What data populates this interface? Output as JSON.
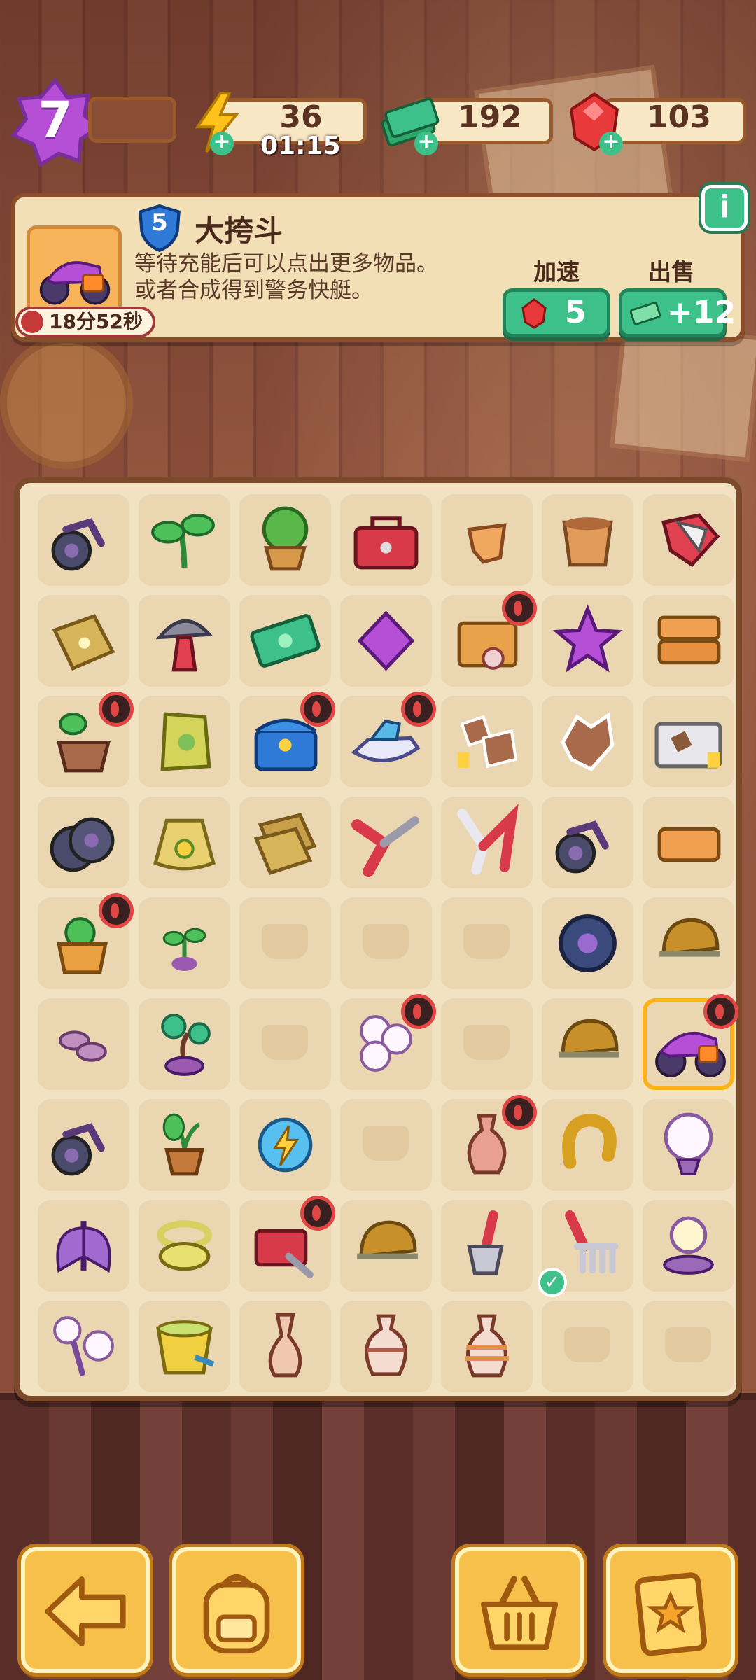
{
  "hud": {
    "level": "7",
    "energy": "36",
    "energy_timer": "01:15",
    "cash": "192",
    "gems": "103"
  },
  "item_panel": {
    "item_level": "5",
    "item_name": "大挎斗",
    "description_line1": "等待充能后可以点出更多物品。",
    "description_line2": "或者合成得到警务快艇。",
    "timer": "18分52秒",
    "speedup_label": "加速",
    "speedup_cost": "5",
    "sell_label": "出售",
    "sell_value": "+12",
    "info_label": "i"
  },
  "board": {
    "rows": [
      [
        "bike",
        "sprout",
        "tree-pot",
        "toolbox",
        "pot-shard",
        "clay-pot",
        "gloves"
      ],
      [
        "seed-packet",
        "mushroom-axe",
        "cash",
        "purple-gem",
        "crate-lock",
        "purple-star",
        "jd-parcels"
      ],
      [
        "plant-pot-lock",
        "seed-bag",
        "treasure-chest-lock",
        "jetski-lock",
        "leaves-tags",
        "leaf",
        "leaf-box"
      ],
      [
        "bike-wheels",
        "flower-sack",
        "seed-packets",
        "pruner-red",
        "pruner-white",
        "bike",
        "jd-parcel"
      ],
      [
        "herb-pot-lock",
        "sprout-small",
        "empty",
        "empty",
        "empty",
        "wheel",
        "helmet"
      ],
      [
        "beans",
        "bonsai",
        "empty",
        "lamp-lock",
        "empty",
        "helmet",
        "motorcycle-lock"
      ],
      [
        "bike",
        "potted-plant",
        "energy-orb",
        "empty",
        "vase-lock",
        "horseshoe",
        "bulb-lamp"
      ],
      [
        "moth",
        "hose",
        "tool-cart-lock",
        "helmet",
        "shovel",
        "rake",
        "bulb"
      ],
      [
        "lamp-cluster",
        "bucket",
        "vase-tall",
        "vase-round",
        "vase-stripe",
        "empty",
        "empty"
      ]
    ]
  },
  "colors": {
    "accent_green": "#3ec08a",
    "board_bg": "#f3e2c2",
    "level_purple": "#b44fd6"
  },
  "bottom_bar": [
    "back-arrow-icon",
    "backpack-icon",
    "basket-icon",
    "task-clipboard-icon"
  ]
}
